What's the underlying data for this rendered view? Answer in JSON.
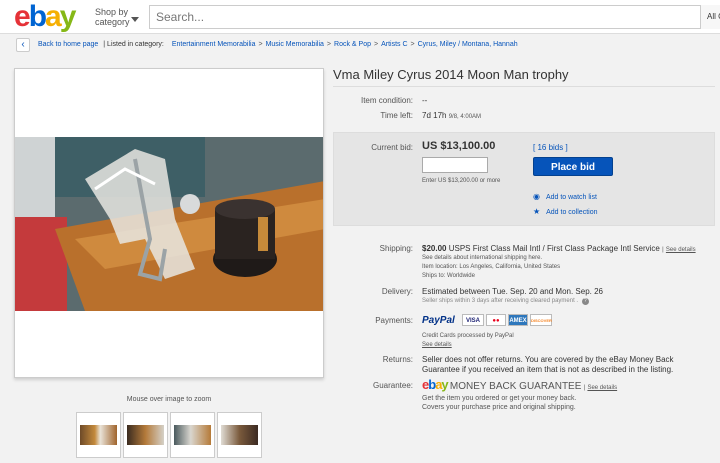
{
  "header": {
    "logo_letters": [
      "e",
      "b",
      "a",
      "y"
    ],
    "logo_colors": [
      "#e53238",
      "#0064d2",
      "#f5af02",
      "#86b817"
    ],
    "shop_by_line1": "Shop by",
    "shop_by_line2": "category",
    "search_placeholder": "Search...",
    "all_categories": "All C"
  },
  "breadcrumb": {
    "back_label": "Back to home page",
    "listed_in": "| Listed in category:",
    "items": [
      "Entertainment Memorabilia",
      "Music Memorabilia",
      "Rock & Pop",
      "Artists C",
      "Cyrus, Miley / Montana, Hannah"
    ]
  },
  "gallery": {
    "zoom_hint": "Mouse over image to zoom",
    "thumb_count": 4
  },
  "item": {
    "title": "Vma Miley Cyrus 2014 Moon Man trophy",
    "condition_label": "Item condition:",
    "condition_value": "--",
    "time_left_label": "Time left:",
    "time_left_value": "7d 17h",
    "time_left_detail": "9/8, 4:00AM"
  },
  "bid": {
    "current_bid_label": "Current bid:",
    "current_bid_value": "US $13,100.00",
    "bids_link": "[ 16 bids ]",
    "enter_hint": "Enter US $13,200.00 or more",
    "place_bid": "Place bid",
    "watch_list": "Add to watch list",
    "add_collection": "Add to collection"
  },
  "shipping": {
    "label": "Shipping:",
    "price": "$20.00",
    "service": "USPS First Class Mail Intl / First Class Package Intl Service",
    "see_details": "See details",
    "details_line": "See details about international shipping here.",
    "location": "Item location:  Los Angeles, California, United States",
    "ships_to": "Ships to:  Worldwide"
  },
  "delivery": {
    "label": "Delivery:",
    "text": "Estimated between Tue. Sep. 20 and Mon. Sep. 26",
    "note": "Seller ships within 3 days after receiving cleared payment ."
  },
  "payments": {
    "label": "Payments:",
    "paypal": "PayPal",
    "cards": [
      "VISA",
      "MC",
      "AMEX",
      "DISCOVER"
    ],
    "credit_note": "Credit Cards processed by PayPal",
    "see_details": "See details"
  },
  "returns": {
    "label": "Returns:",
    "text1": "Seller does not offer returns. You are covered by the eBay Money Back",
    "text2": "Guarantee if you received an item that is not as described in the listing."
  },
  "guarantee": {
    "label": "Guarantee:",
    "title": "MONEY BACK GUARANTEE",
    "see_details": "See details",
    "line1": "Get the item you ordered or get your money back.",
    "line2": "Covers your purchase price and original shipping."
  }
}
